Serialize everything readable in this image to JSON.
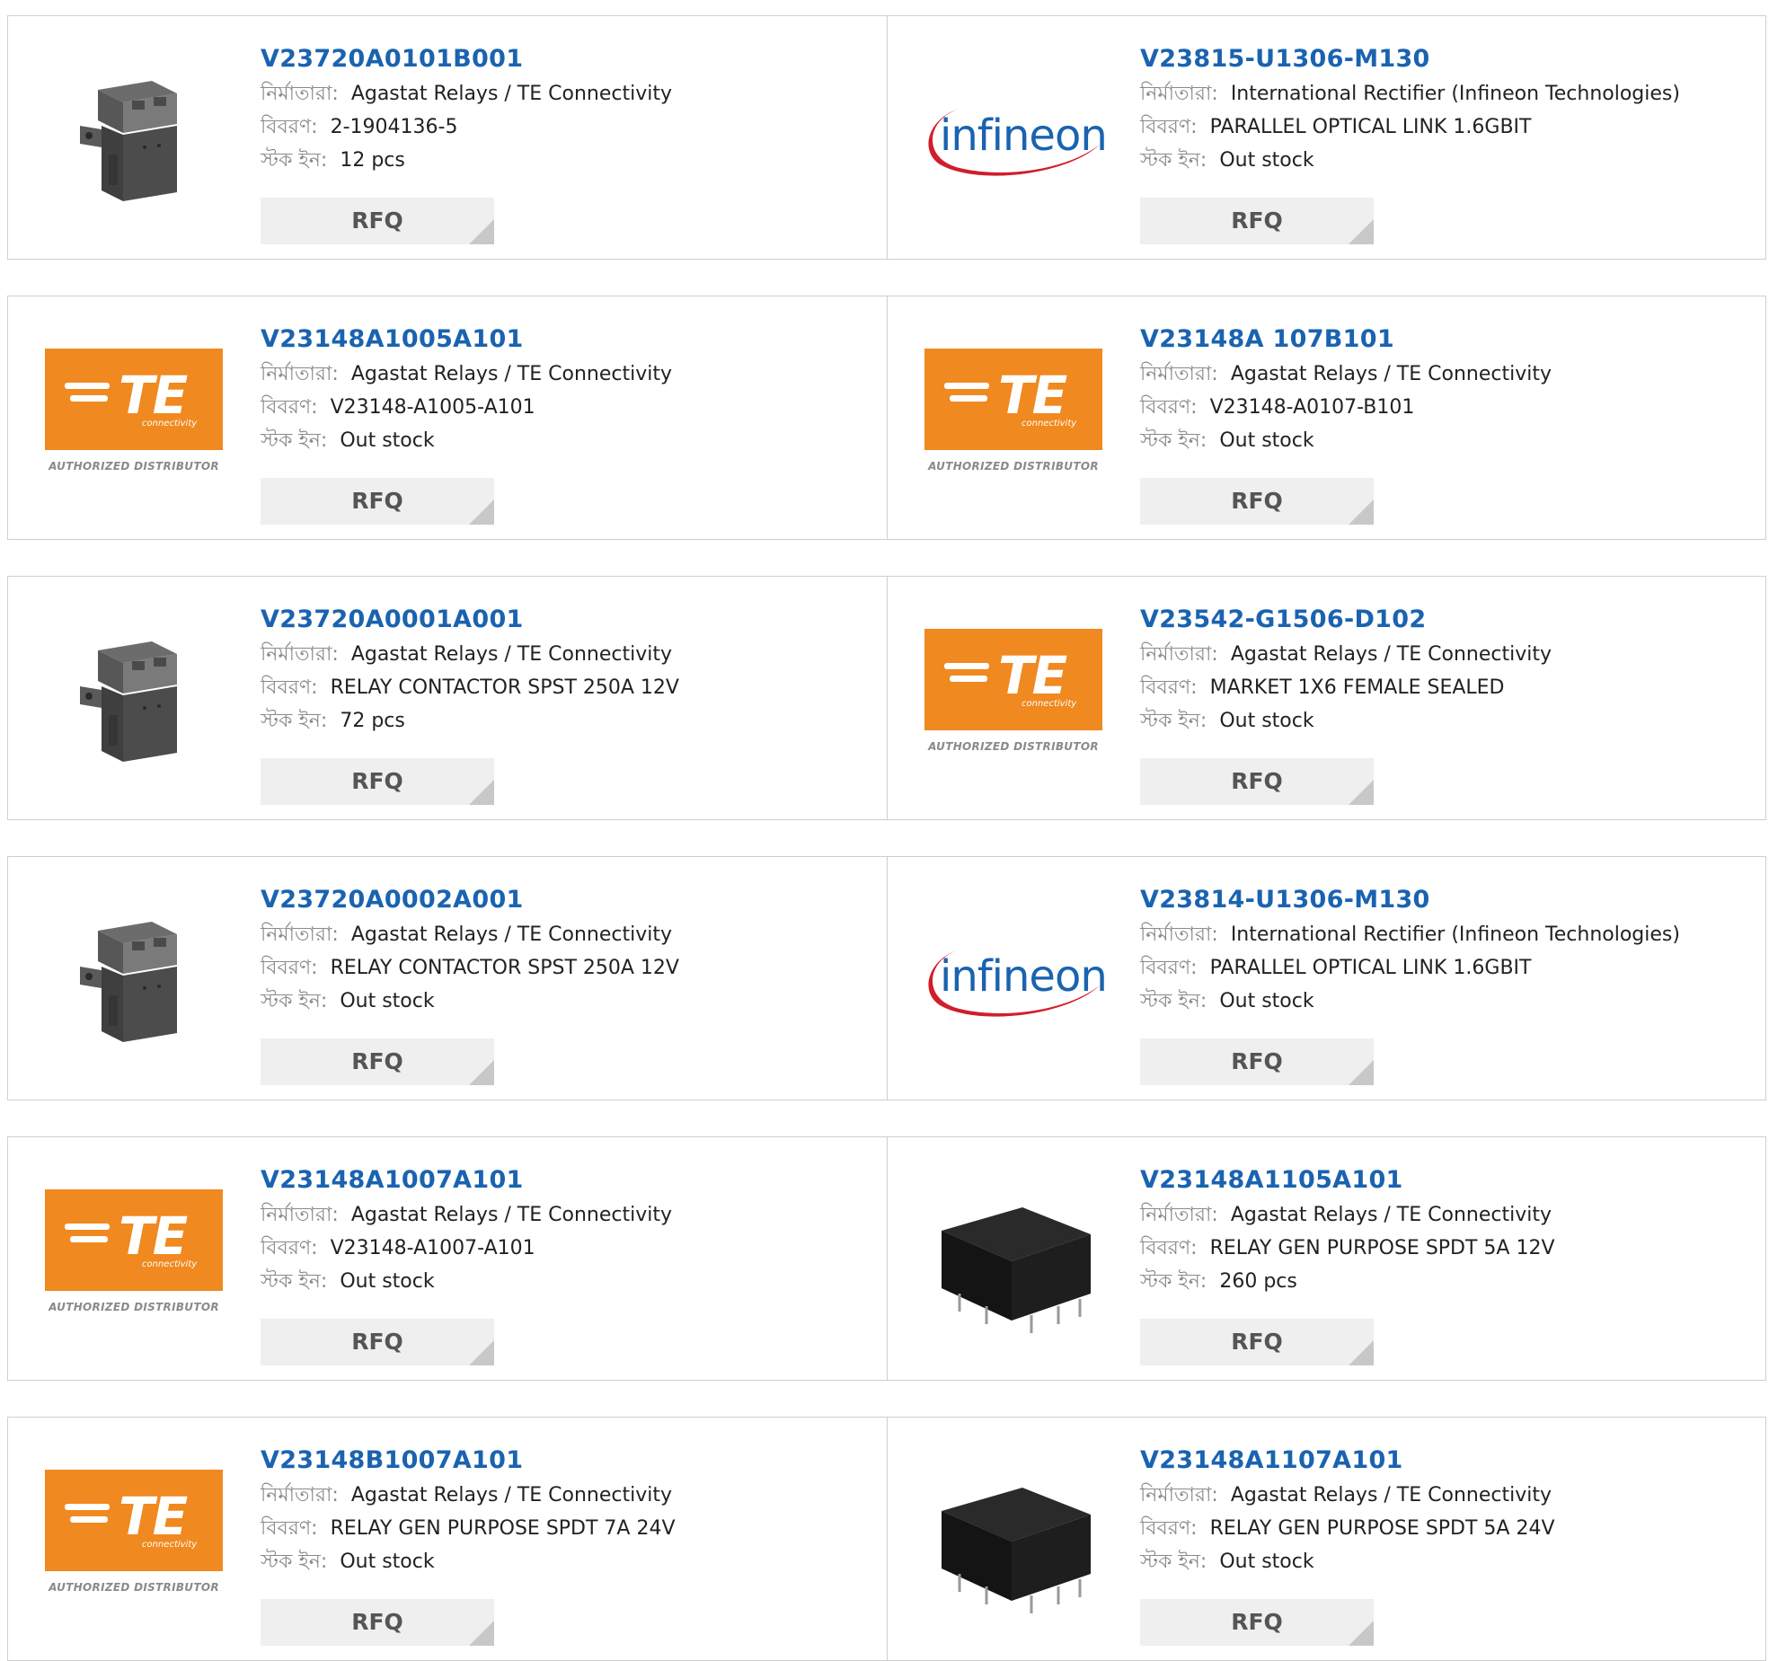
{
  "labels": {
    "manufacturer": "নির্মাতারা:",
    "description": "বিবরণ:",
    "stock": "স্টক ইন:",
    "rfq": "RFQ"
  },
  "products": [
    {
      "part": "V23720A0101B001",
      "manufacturer": "Agastat Relays / TE Connectivity",
      "description": "2-1904136-5",
      "stock": "12 pcs",
      "image": "contactor-relay-photo"
    },
    {
      "part": "V23815-U1306-M130",
      "manufacturer": "International Rectifier (Infineon Technologies)",
      "description": "PARALLEL OPTICAL LINK 1.6GBIT",
      "stock": "Out stock",
      "image": "infineon-logo"
    },
    {
      "part": "V23148A1005A101",
      "manufacturer": "Agastat Relays / TE Connectivity",
      "description": "V23148-A1005-A101",
      "stock": "Out stock",
      "image": "te-logo"
    },
    {
      "part": "V23148A 107B101",
      "manufacturer": "Agastat Relays / TE Connectivity",
      "description": "V23148-A0107-B101",
      "stock": "Out stock",
      "image": "te-logo"
    },
    {
      "part": "V23720A0001A001",
      "manufacturer": "Agastat Relays / TE Connectivity",
      "description": "RELAY CONTACTOR SPST 250A 12V",
      "stock": "72 pcs",
      "image": "contactor-relay-photo"
    },
    {
      "part": "V23542-G1506-D102",
      "manufacturer": "Agastat Relays / TE Connectivity",
      "description": "MARKET 1X6 FEMALE SEALED",
      "stock": "Out stock",
      "image": "te-logo"
    },
    {
      "part": "V23720A0002A001",
      "manufacturer": "Agastat Relays / TE Connectivity",
      "description": "RELAY CONTACTOR SPST 250A 12V",
      "stock": "Out stock",
      "image": "contactor-relay-photo"
    },
    {
      "part": "V23814-U1306-M130",
      "manufacturer": "International Rectifier (Infineon Technologies)",
      "description": "PARALLEL OPTICAL LINK 1.6GBIT",
      "stock": "Out stock",
      "image": "infineon-logo"
    },
    {
      "part": "V23148A1007A101",
      "manufacturer": "Agastat Relays / TE Connectivity",
      "description": "V23148-A1007-A101",
      "stock": "Out stock",
      "image": "te-logo"
    },
    {
      "part": "V23148A1105A101",
      "manufacturer": "Agastat Relays / TE Connectivity",
      "description": "RELAY GEN PURPOSE SPDT 5A 12V",
      "stock": "260 pcs",
      "image": "signal-relay-photo"
    },
    {
      "part": "V23148B1007A101",
      "manufacturer": "Agastat Relays / TE Connectivity",
      "description": "RELAY GEN PURPOSE SPDT 7A 24V",
      "stock": "Out stock",
      "image": "te-logo"
    },
    {
      "part": "V23148A1107A101",
      "manufacturer": "Agastat Relays / TE Connectivity",
      "description": "RELAY GEN PURPOSE SPDT 5A 24V",
      "stock": "Out stock",
      "image": "signal-relay-photo"
    }
  ],
  "logos": {
    "te_text": "TE",
    "te_sub": "connectivity",
    "te_authorized": "AUTHORIZED DISTRIBUTOR",
    "infineon_text": "infineon"
  },
  "colors": {
    "part_link": "#1a63b0",
    "te_orange": "#f0891f",
    "infineon_red": "#d11e2c",
    "infineon_blue": "#1a63b0",
    "rfq_bg": "#efefef"
  }
}
